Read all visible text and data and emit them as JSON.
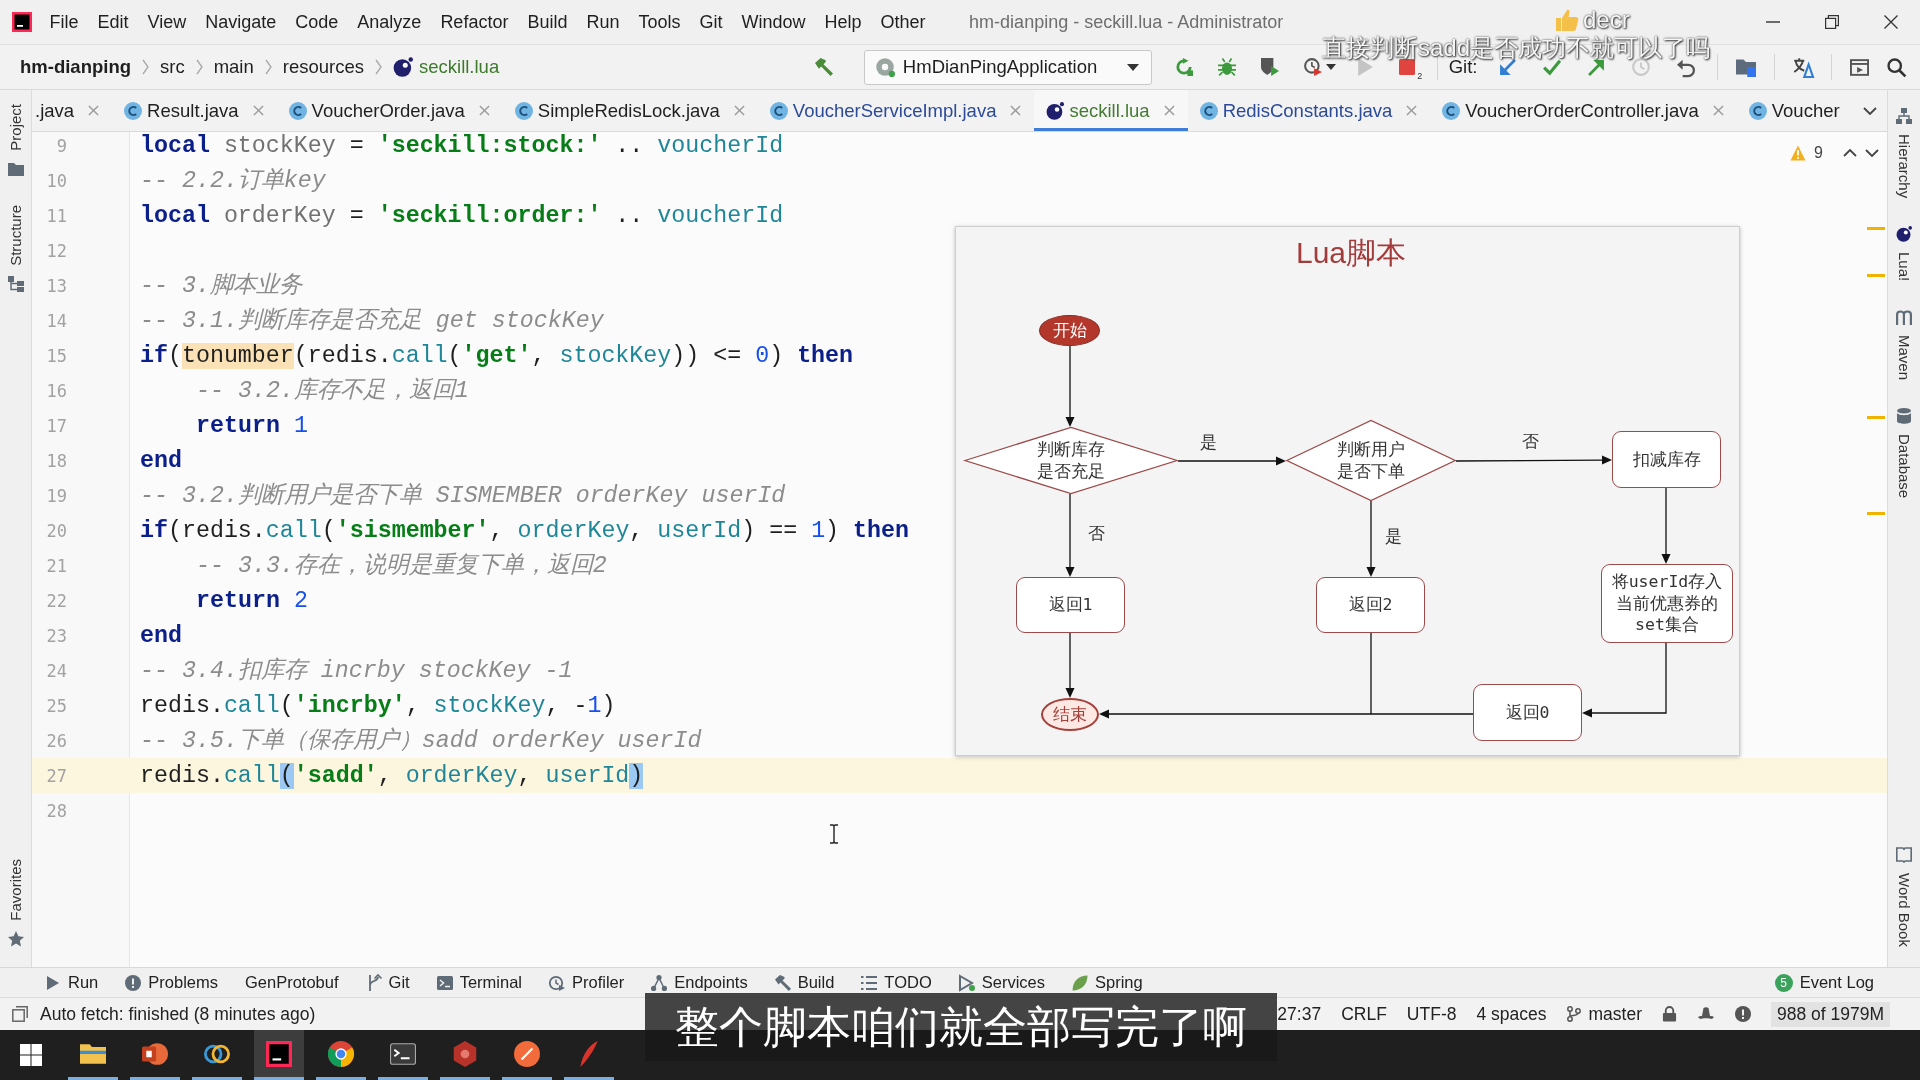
{
  "window": {
    "title": "hm-dianping - seckill.lua - Administrator"
  },
  "menu": [
    "File",
    "Edit",
    "View",
    "Navigate",
    "Code",
    "Analyze",
    "Refactor",
    "Build",
    "Run",
    "Tools",
    "Git",
    "Window",
    "Help",
    "Other"
  ],
  "breadcrumbs": [
    {
      "text": "hm-dianping",
      "kind": "project"
    },
    {
      "text": "src",
      "kind": "folder"
    },
    {
      "text": "main",
      "kind": "folder"
    },
    {
      "text": "resources",
      "kind": "folder"
    },
    {
      "text": "seckill.lua",
      "kind": "file"
    }
  ],
  "toolbar": {
    "run_config": "HmDianPingApplication",
    "stop_count": "2",
    "git_label": "Git:"
  },
  "tabs": [
    {
      "label": ".java",
      "kind": "clipped",
      "color": "#1f1f1f",
      "selected": false,
      "closable": true
    },
    {
      "label": "Result.java",
      "kind": "class",
      "color": "#1f1f1f",
      "selected": false,
      "closable": true
    },
    {
      "label": "VoucherOrder.java",
      "kind": "class",
      "color": "#1f1f1f",
      "selected": false,
      "closable": true
    },
    {
      "label": "SimpleRedisLock.java",
      "kind": "class",
      "color": "#1f1f1f",
      "selected": false,
      "closable": true
    },
    {
      "label": "VoucherServiceImpl.java",
      "kind": "class",
      "color": "#2b4a9a",
      "selected": false,
      "closable": true
    },
    {
      "label": "seckill.lua",
      "kind": "script",
      "color": "#457a32",
      "selected": true,
      "closable": true
    },
    {
      "label": "RedisConstants.java",
      "kind": "class",
      "color": "#2b4a9a",
      "selected": false,
      "closable": true
    },
    {
      "label": "VoucherOrderController.java",
      "kind": "class",
      "color": "#1f1f1f",
      "selected": false,
      "closable": true
    },
    {
      "label": "Voucher",
      "kind": "class",
      "color": "#1f1f1f",
      "selected": false,
      "closable": false
    }
  ],
  "left_tools": [
    {
      "label": "Project",
      "kind": "project"
    },
    {
      "label": "Structure",
      "kind": "structure"
    },
    {
      "label": "Favorites",
      "kind": "favorites"
    }
  ],
  "right_tools": [
    {
      "label": "Hierarchy",
      "kind": "hierarchy"
    },
    {
      "label": "Lua!",
      "kind": "lua"
    },
    {
      "label": "Maven",
      "kind": "maven"
    },
    {
      "label": "Database",
      "kind": "database"
    },
    {
      "label": "Word Book",
      "kind": "book"
    }
  ],
  "editor": {
    "warning_count": "9",
    "lines": [
      {
        "number": "9",
        "current": false,
        "tokens": [
          {
            "text": "local ",
            "kind": "keyword"
          },
          {
            "text": "stockKey",
            "kind": "local"
          },
          {
            "text": " = ",
            "kind": "plain"
          },
          {
            "text": "'seckill:stock:'",
            "kind": "string"
          },
          {
            "text": " .. ",
            "kind": "plain"
          },
          {
            "text": "voucherId",
            "kind": "global"
          }
        ]
      },
      {
        "number": "10",
        "current": false,
        "tokens": [
          {
            "text": "-- 2.2.订单key",
            "kind": "comment"
          }
        ]
      },
      {
        "number": "11",
        "current": false,
        "tokens": [
          {
            "text": "local ",
            "kind": "keyword"
          },
          {
            "text": "orderKey",
            "kind": "local"
          },
          {
            "text": " = ",
            "kind": "plain"
          },
          {
            "text": "'seckill:order:'",
            "kind": "string"
          },
          {
            "text": " .. ",
            "kind": "plain"
          },
          {
            "text": "voucherId",
            "kind": "global"
          }
        ]
      },
      {
        "number": "12",
        "current": false
      },
      {
        "number": "13",
        "current": false,
        "tokens": [
          {
            "text": "-- 3.脚本业务",
            "kind": "comment"
          }
        ]
      },
      {
        "number": "14",
        "current": false,
        "tokens": [
          {
            "text": "-- 3.1.判断库存是否充足 get stockKey",
            "kind": "comment"
          }
        ]
      },
      {
        "number": "15",
        "current": false,
        "tokens": [
          {
            "text": "if",
            "kind": "keyword"
          },
          {
            "text": "(",
            "kind": "plain"
          },
          {
            "text": "tonumber",
            "kind": "search"
          },
          {
            "text": "(redis.",
            "kind": "plain"
          },
          {
            "text": "call",
            "kind": "call"
          },
          {
            "text": "(",
            "kind": "plain"
          },
          {
            "text": "'get'",
            "kind": "string"
          },
          {
            "text": ", ",
            "kind": "plain"
          },
          {
            "text": "stockKey",
            "kind": "global"
          },
          {
            "text": ")) <= ",
            "kind": "plain"
          },
          {
            "text": "0",
            "kind": "number"
          },
          {
            "text": ") ",
            "kind": "plain"
          },
          {
            "text": "then",
            "kind": "keyword"
          }
        ],
        "children": [
          {
            "number": "16",
            "current": false,
            "tokens": [
              {
                "text": "-- 3.2.库存不足，返回1",
                "kind": "comment"
              }
            ]
          },
          {
            "number": "17",
            "current": false,
            "tokens": [
              {
                "text": "return ",
                "kind": "keyword"
              },
              {
                "text": "1",
                "kind": "number"
              }
            ]
          }
        ]
      },
      {
        "number": "18",
        "current": false,
        "tokens": [
          {
            "text": "end",
            "kind": "keyword"
          }
        ]
      },
      {
        "number": "19",
        "current": false,
        "tokens": [
          {
            "text": "-- 3.2.判断用户是否下单 SISMEMBER orderKey userId",
            "kind": "comment"
          }
        ]
      },
      {
        "number": "20",
        "current": false,
        "tokens": [
          {
            "text": "if",
            "kind": "keyword"
          },
          {
            "text": "(redis.",
            "kind": "plain"
          },
          {
            "text": "call",
            "kind": "call"
          },
          {
            "text": "(",
            "kind": "plain"
          },
          {
            "text": "'sismember'",
            "kind": "string"
          },
          {
            "text": ", ",
            "kind": "plain"
          },
          {
            "text": "orderKey",
            "kind": "global"
          },
          {
            "text": ", ",
            "kind": "plain"
          },
          {
            "text": "userId",
            "kind": "global"
          },
          {
            "text": ") == ",
            "kind": "plain"
          },
          {
            "text": "1",
            "kind": "number"
          },
          {
            "text": ") ",
            "kind": "plain"
          },
          {
            "text": "then",
            "kind": "keyword"
          }
        ],
        "children": [
          {
            "number": "21",
            "current": false,
            "tokens": [
              {
                "text": "-- 3.3.存在，说明是重复下单，返回2",
                "kind": "comment"
              }
            ]
          },
          {
            "number": "22",
            "current": false,
            "tokens": [
              {
                "text": "return ",
                "kind": "keyword"
              },
              {
                "text": "2",
                "kind": "number"
              }
            ]
          }
        ]
      },
      {
        "number": "23",
        "current": false,
        "tokens": [
          {
            "text": "end",
            "kind": "keyword"
          }
        ]
      },
      {
        "number": "24",
        "current": false,
        "tokens": [
          {
            "text": "-- 3.4.扣库存 incrby stockKey -1",
            "kind": "comment"
          }
        ]
      },
      {
        "number": "25",
        "current": false,
        "tokens": [
          {
            "text": "redis.",
            "kind": "plain"
          },
          {
            "text": "call",
            "kind": "call"
          },
          {
            "text": "(",
            "kind": "plain"
          },
          {
            "text": "'incrby'",
            "kind": "string"
          },
          {
            "text": ", ",
            "kind": "plain"
          },
          {
            "text": "stockKey",
            "kind": "global"
          },
          {
            "text": ", -",
            "kind": "plain"
          },
          {
            "text": "1",
            "kind": "number"
          },
          {
            "text": ")",
            "kind": "plain"
          }
        ]
      },
      {
        "number": "26",
        "current": false,
        "tokens": [
          {
            "text": "-- 3.5.下单（保存用户）sadd orderKey userId",
            "kind": "comment"
          }
        ]
      },
      {
        "number": "27",
        "current": true,
        "tokens": [
          {
            "text": "redis.",
            "kind": "plain"
          },
          {
            "text": "call",
            "kind": "call"
          },
          {
            "text": "(",
            "kind": "brace"
          },
          {
            "text": "'sadd'",
            "kind": "string"
          },
          {
            "text": ", ",
            "kind": "plain"
          },
          {
            "text": "orderKey",
            "kind": "global"
          },
          {
            "text": ", ",
            "kind": "plain"
          },
          {
            "text": "userId",
            "kind": "global"
          },
          {
            "text": ")",
            "kind": "brace"
          }
        ]
      },
      {
        "number": "28",
        "current": false
      }
    ]
  },
  "flowchart": {
    "title": "Lua脚本",
    "nodes": [
      {
        "kind": "start",
        "lines": [
          "开始"
        ]
      },
      {
        "kind": "decision",
        "lines": [
          "判断库存",
          "是否充足"
        ]
      },
      {
        "kind": "decision",
        "lines": [
          "判断用户",
          "是否下单"
        ]
      },
      {
        "kind": "process",
        "lines": [
          "扣减库存"
        ]
      },
      {
        "kind": "process",
        "lines": [
          "返回1"
        ]
      },
      {
        "kind": "process",
        "lines": [
          "返回2"
        ]
      },
      {
        "kind": "process",
        "lines": [
          "将userId存入",
          "当前优惠券的",
          "set集合"
        ]
      },
      {
        "kind": "process",
        "lines": [
          "返回0"
        ]
      },
      {
        "kind": "end",
        "lines": [
          "结束"
        ]
      }
    ],
    "branch_labels": [
      "是",
      "否",
      "否",
      "是"
    ]
  },
  "tool_windows": [
    {
      "label": "Run",
      "kind": "run"
    },
    {
      "label": "Problems",
      "kind": "problems"
    },
    {
      "label": "GenProtobuf"
    },
    {
      "label": "Git",
      "kind": "git"
    },
    {
      "label": "Terminal",
      "kind": "terminal"
    },
    {
      "label": "Profiler",
      "kind": "profiler"
    },
    {
      "label": "Endpoints",
      "kind": "endpoints"
    },
    {
      "label": "Build",
      "kind": "build"
    },
    {
      "label": "TODO",
      "kind": "todo"
    },
    {
      "label": "Services",
      "kind": "services"
    },
    {
      "label": "Spring",
      "kind": "spring"
    }
  ],
  "event_log": {
    "label": "Event Log",
    "count": "5"
  },
  "status_bar": {
    "message": "Auto fetch: finished (8 minutes ago)",
    "position": "27:37",
    "line_separator": "CRLF",
    "encoding": "UTF-8",
    "indent": "4 spaces",
    "branch": "master",
    "memory": "988 of 1979M"
  },
  "taskbar": {
    "apps": [
      {
        "kind": "explorer",
        "selected": false,
        "running": true
      },
      {
        "kind": "slides",
        "selected": false,
        "running": true
      },
      {
        "kind": "rings",
        "selected": false,
        "running": true
      },
      {
        "kind": "ide",
        "selected": true,
        "running": true
      },
      {
        "kind": "browser",
        "selected": false,
        "running": true
      },
      {
        "kind": "terminal",
        "selected": false,
        "running": true
      },
      {
        "kind": "hexagon",
        "selected": false,
        "running": true
      },
      {
        "kind": "disc",
        "selected": false,
        "running": true
      },
      {
        "kind": "feather",
        "selected": false,
        "running": true
      }
    ]
  },
  "overlays": {
    "danmaku": [
      {
        "text": "decr",
        "liked": true
      },
      {
        "text": "直接判断sadd是否成功不就可以了吗",
        "liked": false
      }
    ],
    "subtitle": "整个脚本咱们就全部写完了啊"
  }
}
